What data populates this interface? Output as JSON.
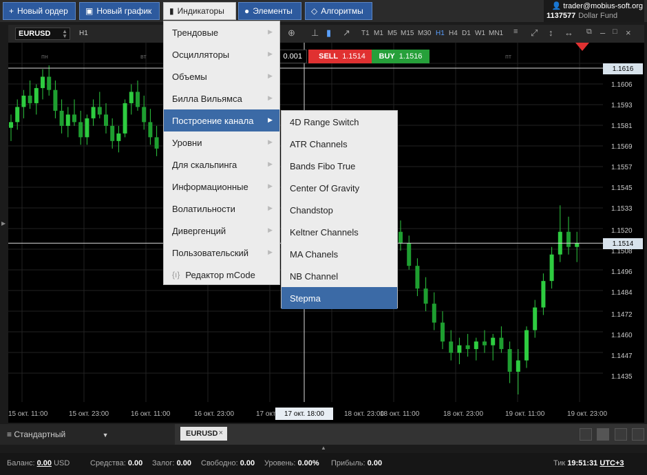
{
  "topbar": {
    "buttons": [
      {
        "label": "Новый ордер",
        "icon": "plus-icon"
      },
      {
        "label": "Новый график",
        "icon": "chart-icon"
      },
      {
        "label": "Индикаторы",
        "icon": "bar-chart-icon"
      },
      {
        "label": "Элементы",
        "icon": "elements-icon"
      },
      {
        "label": "Алгоритмы",
        "icon": "diamond-icon"
      }
    ],
    "account": {
      "user": "trader@mobius-soft.org",
      "id": "1137577",
      "fund": "Dollar Fund"
    }
  },
  "chart_toolbar": {
    "symbol": "EURUSD",
    "timeframe_current": "H1",
    "timeframes": [
      "T1",
      "M1",
      "M5",
      "M15",
      "M30",
      "H1",
      "H4",
      "D1",
      "W1",
      "MN1"
    ],
    "active_timeframe": "H1"
  },
  "trade": {
    "lot": "0.001",
    "sell_label": "SELL",
    "sell_price": "1.1514",
    "buy_label": "BUY",
    "buy_price": "1.1516"
  },
  "indicators_menu": {
    "items": [
      "Трендовые",
      "Осцилляторы",
      "Объемы",
      "Билла Вильямса",
      "Построение канала",
      "Уровни",
      "Для скальпинга",
      "Информационные",
      "Волатильности",
      "Дивергенций",
      "Пользовательский"
    ],
    "selected": "Построение канала",
    "editor_label": "Редактор mCode"
  },
  "channel_submenu": {
    "items": [
      "4D Range Switch",
      "ATR Channels",
      "Bands Fibo True",
      "Center Of Gravity",
      "Chandstop",
      "Keltner Channels",
      "MA Chanels",
      "NB Channel",
      "Stepma"
    ],
    "selected": "Stepma"
  },
  "price_axis": {
    "labels": [
      "1.1606",
      "1.1593",
      "1.1581",
      "1.1569",
      "1.1557",
      "1.1545",
      "1.1533",
      "1.1520",
      "1.1508",
      "1.1496",
      "1.1484",
      "1.1472",
      "1.1460",
      "1.1447",
      "1.1435"
    ],
    "tag_top": "1.1616",
    "tag_current": "1.1514"
  },
  "time_axis": {
    "labels": [
      "15 окт. 11:00",
      "15 окт. 23:00",
      "16 окт. 11:00",
      "16 окт. 23:00",
      "17 окт.",
      "",
      "18 окт. 23:00",
      "18 окт. 11:00",
      "18 окт. 23:00",
      "19 окт. 11:00",
      "19 окт. 23:00"
    ],
    "crosshair_label": "17 окт. 18:00",
    "day_labels": [
      "пн",
      "вт",
      "ср",
      "чт",
      "пт"
    ]
  },
  "chart_data": {
    "type": "candlestick",
    "symbol": "EURUSD",
    "timeframe": "H1",
    "ylim": [
      1.143,
      1.162
    ],
    "bid": 1.1514,
    "ask": 1.1516,
    "ohlc": [
      [
        1.1575,
        1.1582,
        1.1568,
        1.1578
      ],
      [
        1.1578,
        1.159,
        1.1574,
        1.1586
      ],
      [
        1.1586,
        1.1595,
        1.158,
        1.1592
      ],
      [
        1.1592,
        1.16,
        1.1585,
        1.1588
      ],
      [
        1.1588,
        1.1598,
        1.1582,
        1.1596
      ],
      [
        1.1596,
        1.1606,
        1.159,
        1.1602
      ],
      [
        1.1602,
        1.1608,
        1.1592,
        1.1595
      ],
      [
        1.1595,
        1.16,
        1.158,
        1.1584
      ],
      [
        1.1584,
        1.159,
        1.1572,
        1.1576
      ],
      [
        1.1576,
        1.1586,
        1.157,
        1.1582
      ],
      [
        1.1582,
        1.159,
        1.1576,
        1.1578
      ],
      [
        1.1578,
        1.1584,
        1.1566,
        1.157
      ],
      [
        1.157,
        1.1582,
        1.1566,
        1.158
      ],
      [
        1.158,
        1.159,
        1.1576,
        1.1586
      ],
      [
        1.1586,
        1.1594,
        1.158,
        1.1582
      ],
      [
        1.1582,
        1.1588,
        1.1572,
        1.1576
      ],
      [
        1.1576,
        1.158,
        1.1564,
        1.1568
      ],
      [
        1.1568,
        1.1576,
        1.1562,
        1.1572
      ],
      [
        1.1572,
        1.159,
        1.157,
        1.1588
      ],
      [
        1.1588,
        1.1598,
        1.1582,
        1.1594
      ],
      [
        1.1594,
        1.16,
        1.1584,
        1.1586
      ],
      [
        1.1586,
        1.1592,
        1.1574,
        1.1578
      ],
      [
        1.1578,
        1.1585,
        1.1566,
        1.157
      ],
      [
        1.157,
        1.1576,
        1.156,
        1.1564
      ],
      [
        1.152,
        1.1526,
        1.151,
        1.1514
      ],
      [
        1.1514,
        1.1518,
        1.15,
        1.1502
      ],
      [
        1.1502,
        1.1506,
        1.1486,
        1.149
      ],
      [
        1.149,
        1.1496,
        1.1478,
        1.1482
      ],
      [
        1.1482,
        1.1488,
        1.1468,
        1.1472
      ],
      [
        1.1472,
        1.1478,
        1.1458,
        1.1462
      ],
      [
        1.1462,
        1.1468,
        1.1452,
        1.1456
      ],
      [
        1.1456,
        1.1464,
        1.145,
        1.146
      ],
      [
        1.146,
        1.1466,
        1.1454,
        1.1458
      ],
      [
        1.1458,
        1.1464,
        1.1452,
        1.1462
      ],
      [
        1.1462,
        1.1468,
        1.1456,
        1.146
      ],
      [
        1.146,
        1.1466,
        1.1452,
        1.1464
      ],
      [
        1.1464,
        1.147,
        1.1456,
        1.1458
      ],
      [
        1.1458,
        1.1462,
        1.144,
        1.1446
      ],
      [
        1.1446,
        1.1458,
        1.1434,
        1.1452
      ],
      [
        1.1452,
        1.147,
        1.1448,
        1.1468
      ],
      [
        1.1468,
        1.1484,
        1.1464,
        1.148
      ],
      [
        1.148,
        1.1498,
        1.1476,
        1.1494
      ],
      [
        1.1494,
        1.1512,
        1.149,
        1.1508
      ],
      [
        1.1508,
        1.1534,
        1.1504,
        1.152
      ],
      [
        1.152,
        1.1528,
        1.1508,
        1.1512
      ],
      [
        1.1512,
        1.152,
        1.1504,
        1.1514
      ]
    ]
  },
  "bottom_tabs": {
    "layout": "Стандартный",
    "symbol_tab": "EURUSD"
  },
  "status": {
    "balance_label": "Баланс:",
    "balance": "0.00",
    "currency": "USD",
    "equity_label": "Средства:",
    "equity": "0.00",
    "margin_label": "Залог:",
    "margin": "0.00",
    "free_label": "Свободно:",
    "free": "0.00",
    "level_label": "Уровень:",
    "level": "0.00%",
    "profit_label": "Прибыль:",
    "profit": "0.00",
    "tick_label": "Тик",
    "tick_time": "19:51:31",
    "timezone": "UTC+3"
  },
  "colors": {
    "up": "#2ecc40",
    "down": "#2ecc40",
    "accent": "#3b6aa6",
    "sell": "#e03131",
    "buy": "#26a03a"
  }
}
